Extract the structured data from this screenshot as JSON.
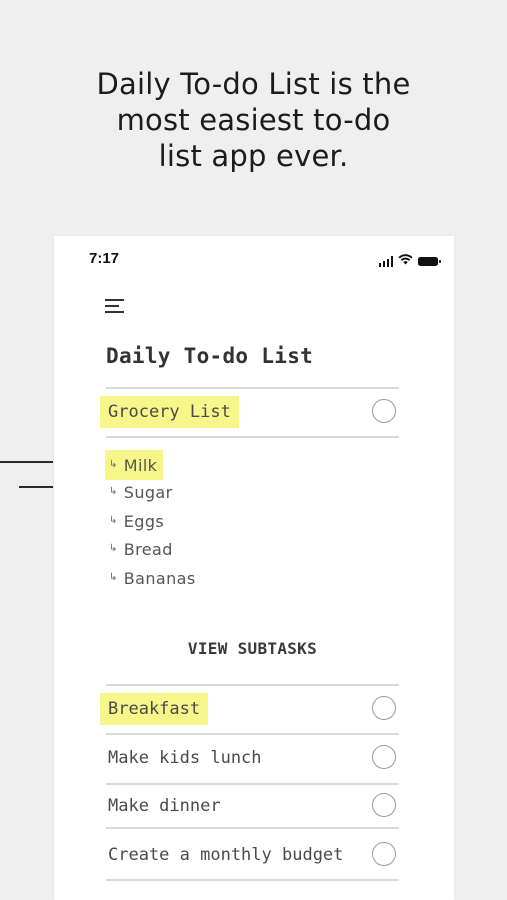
{
  "promo": {
    "headline_lines": [
      "Daily To-do List is the",
      "most easiest to-do",
      "list app ever."
    ]
  },
  "status_bar": {
    "time": "7:17",
    "icons": [
      "signal-icon",
      "wifi-icon",
      "battery-icon"
    ]
  },
  "app": {
    "menu_icon": "hamburger-menu-icon",
    "title": "Daily To-do List",
    "highlight_color": "#f6f68a",
    "featured_task": {
      "label": "Grocery List",
      "highlighted": true,
      "subtasks": [
        {
          "label": "Milk",
          "highlighted": true
        },
        {
          "label": "Sugar",
          "highlighted": false
        },
        {
          "label": "Eggs",
          "highlighted": false
        },
        {
          "label": "Bread",
          "highlighted": false
        },
        {
          "label": "Bananas",
          "highlighted": false
        }
      ]
    },
    "view_subtasks_label": "VIEW SUBTASKS",
    "tasks": [
      {
        "label": "Breakfast",
        "highlighted": true
      },
      {
        "label": "Make kids lunch",
        "highlighted": false
      },
      {
        "label": "Make dinner",
        "highlighted": false
      },
      {
        "label": "Create a monthly budget",
        "highlighted": false
      }
    ]
  }
}
